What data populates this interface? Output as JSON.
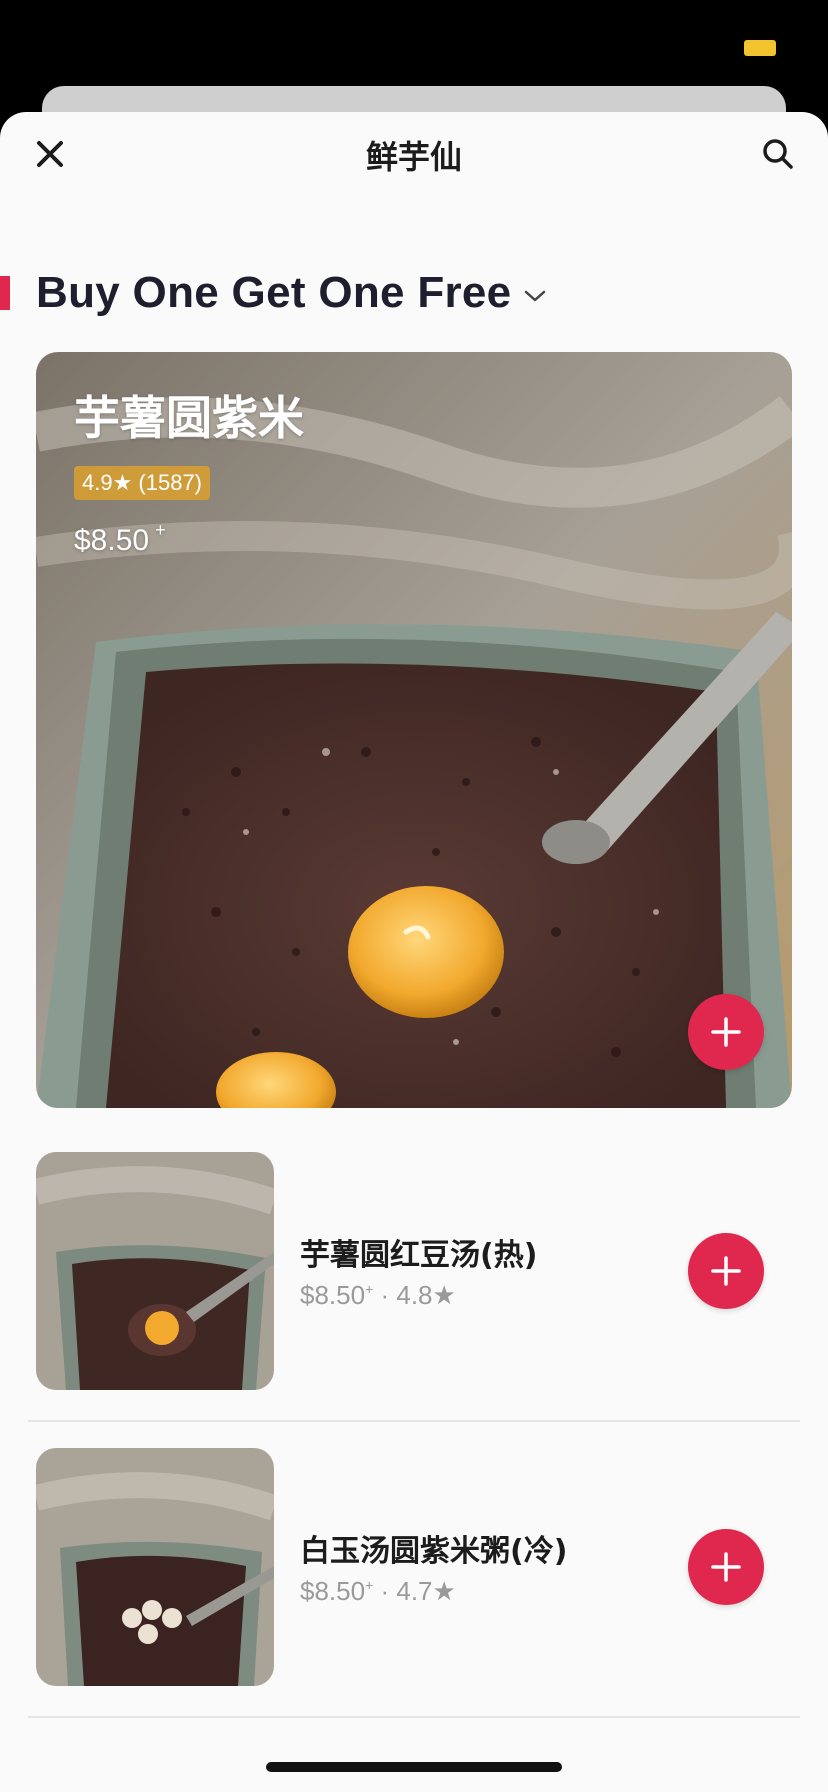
{
  "nav": {
    "title": "鲜芋仙"
  },
  "section": {
    "title": "Buy One Get One Free"
  },
  "hero": {
    "name": "芋薯圆紫米",
    "rating": "4.9★ (1587)",
    "price": "$8.50",
    "price_suffix": "+"
  },
  "items": [
    {
      "name": "芋薯圆红豆汤(热)",
      "price": "$8.50",
      "price_suffix": "+",
      "rating": " · 4.8★"
    },
    {
      "name": "白玉汤圆紫米粥(冷)",
      "price": "$8.50",
      "price_suffix": "+",
      "rating": " · 4.7★"
    }
  ],
  "colors": {
    "accent": "#e0284f",
    "rating_badge": "#d69e32"
  },
  "icons": {
    "close": "close-icon",
    "search": "search-icon",
    "chevron": "chevron-down-icon",
    "add": "plus-icon"
  }
}
